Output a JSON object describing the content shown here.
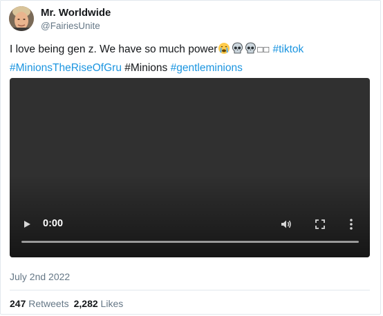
{
  "author": {
    "name": "Mr. Worldwide",
    "handle": "@FairiesUnite"
  },
  "tweet": {
    "line1_text": "I love being gen z. We have so much power",
    "line1_emoji_tail": "□□",
    "hashtags": [
      "#tiktok",
      "#MinionsTheRiseOfGru",
      "#Minions",
      "#gentleminions"
    ],
    "emojis": [
      "crying-face-icon",
      "skull-icon",
      "skull-icon"
    ]
  },
  "video": {
    "time": "0:00",
    "progress": 0,
    "controls": [
      "play-icon",
      "volume-icon",
      "fullscreen-icon",
      "more-options-icon"
    ]
  },
  "date": "July 2nd 2022",
  "stats": {
    "retweets_count": "247",
    "retweets_label": "Retweets",
    "likes_count": "2,282",
    "likes_label": "Likes"
  },
  "colors": {
    "link": "#1b95e0",
    "muted": "#657786",
    "text": "#14171a",
    "video_bg": "#303030"
  }
}
